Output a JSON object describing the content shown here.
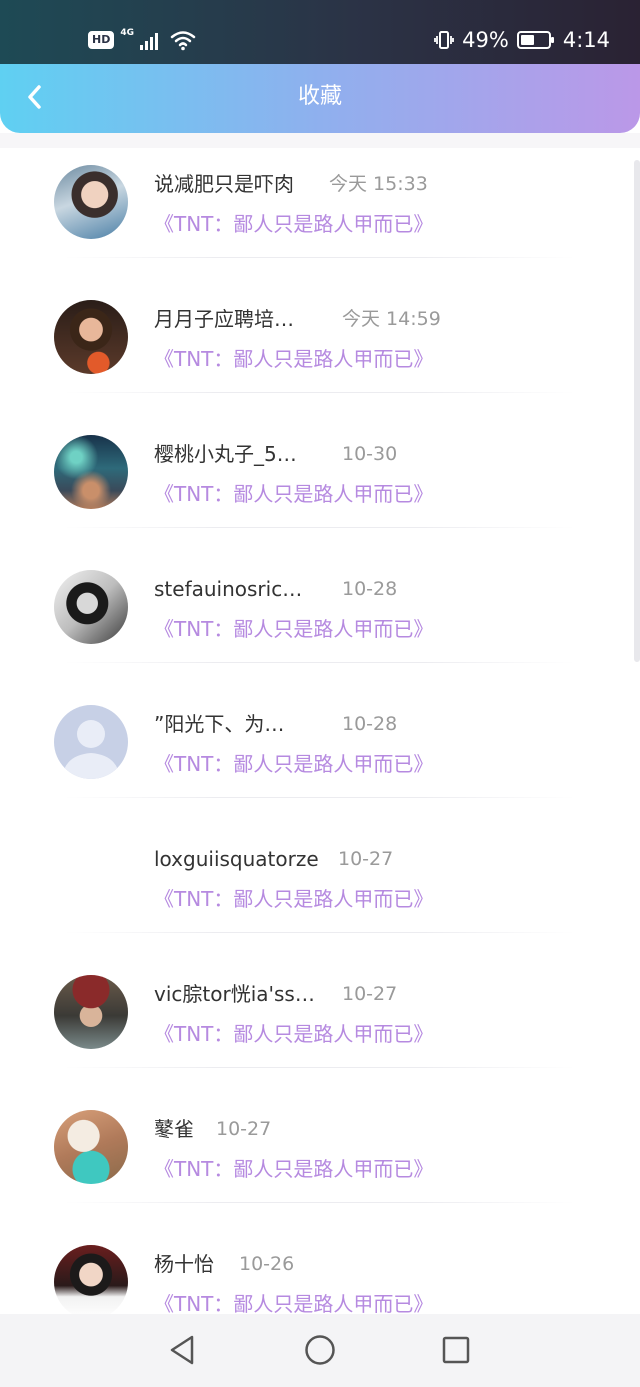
{
  "status_bar": {
    "hd": "HD",
    "network": "4G",
    "battery_percent": "49%",
    "battery_level": 0.49,
    "time": "4:14"
  },
  "header": {
    "title": "收藏",
    "back_icon": "chevron-left-icon"
  },
  "items": [
    {
      "name": "说减肥只是吓肉",
      "time": "今天 15:33",
      "book": "《TNT：鄙人只是路人甲而已》"
    },
    {
      "name": "月月子应聘培…",
      "time": "今天 14:59",
      "book": "《TNT：鄙人只是路人甲而已》"
    },
    {
      "name": "樱桃小丸子_5…",
      "time": "10-30",
      "book": "《TNT：鄙人只是路人甲而已》"
    },
    {
      "name": "stefauinosric…",
      "time": "10-28",
      "book": "《TNT：鄙人只是路人甲而已》"
    },
    {
      "name": "”阳光下、为…",
      "time": "10-28",
      "book": "《TNT：鄙人只是路人甲而已》"
    },
    {
      "name": "loxguiisquatorze",
      "time": "10-27",
      "book": "《TNT：鄙人只是路人甲而已》"
    },
    {
      "name": "vic腙tor恍ia'ss…",
      "time": "10-27",
      "book": "《TNT：鄙人只是路人甲而已》"
    },
    {
      "name": "鼕雀",
      "time": "10-27",
      "book": "《TNT：鄙人只是路人甲而已》"
    },
    {
      "name": "杨十怡",
      "time": "10-26",
      "book": "《TNT：鄙人只是路人甲而已》"
    }
  ],
  "nav_bar": {
    "back_icon": "triangle-back-icon",
    "home_icon": "circle-home-icon",
    "recents_icon": "square-recents-icon"
  },
  "colors": {
    "header_gradient_start": "#5fd0f2",
    "header_gradient_end": "#bb98e8",
    "book_title": "#b68ae0",
    "name_text": "#333333",
    "time_text": "#9a9a9a"
  }
}
